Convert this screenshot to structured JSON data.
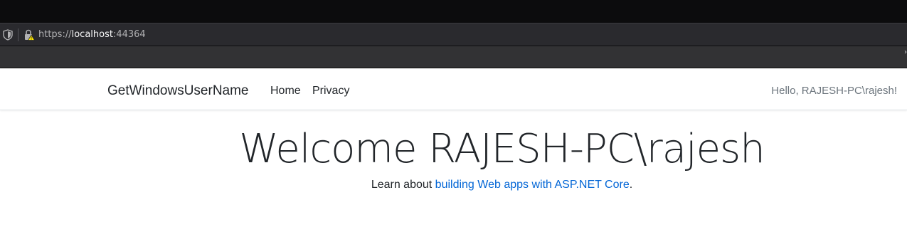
{
  "browser": {
    "url_scheme": "https://",
    "url_host": "localhost",
    "url_port": ":44364",
    "icons": [
      "shield-icon",
      "lock-warning-icon"
    ]
  },
  "navbar": {
    "brand": "GetWindowsUserName",
    "items": [
      {
        "label": "Home"
      },
      {
        "label": "Privacy"
      }
    ],
    "greeting": "Hello, RAJESH-PC\\rajesh!"
  },
  "main": {
    "heading": "Welcome RAJESH-PC\\rajesh",
    "learn_prefix": "Learn about ",
    "learn_link": "building Web apps with ASP.NET Core",
    "learn_suffix": "."
  },
  "colors": {
    "link": "#0366d6",
    "text": "#212529",
    "muted": "#6c757d",
    "chrome_dark": "#0c0c0d",
    "chrome_bar": "#2a2a2e"
  }
}
